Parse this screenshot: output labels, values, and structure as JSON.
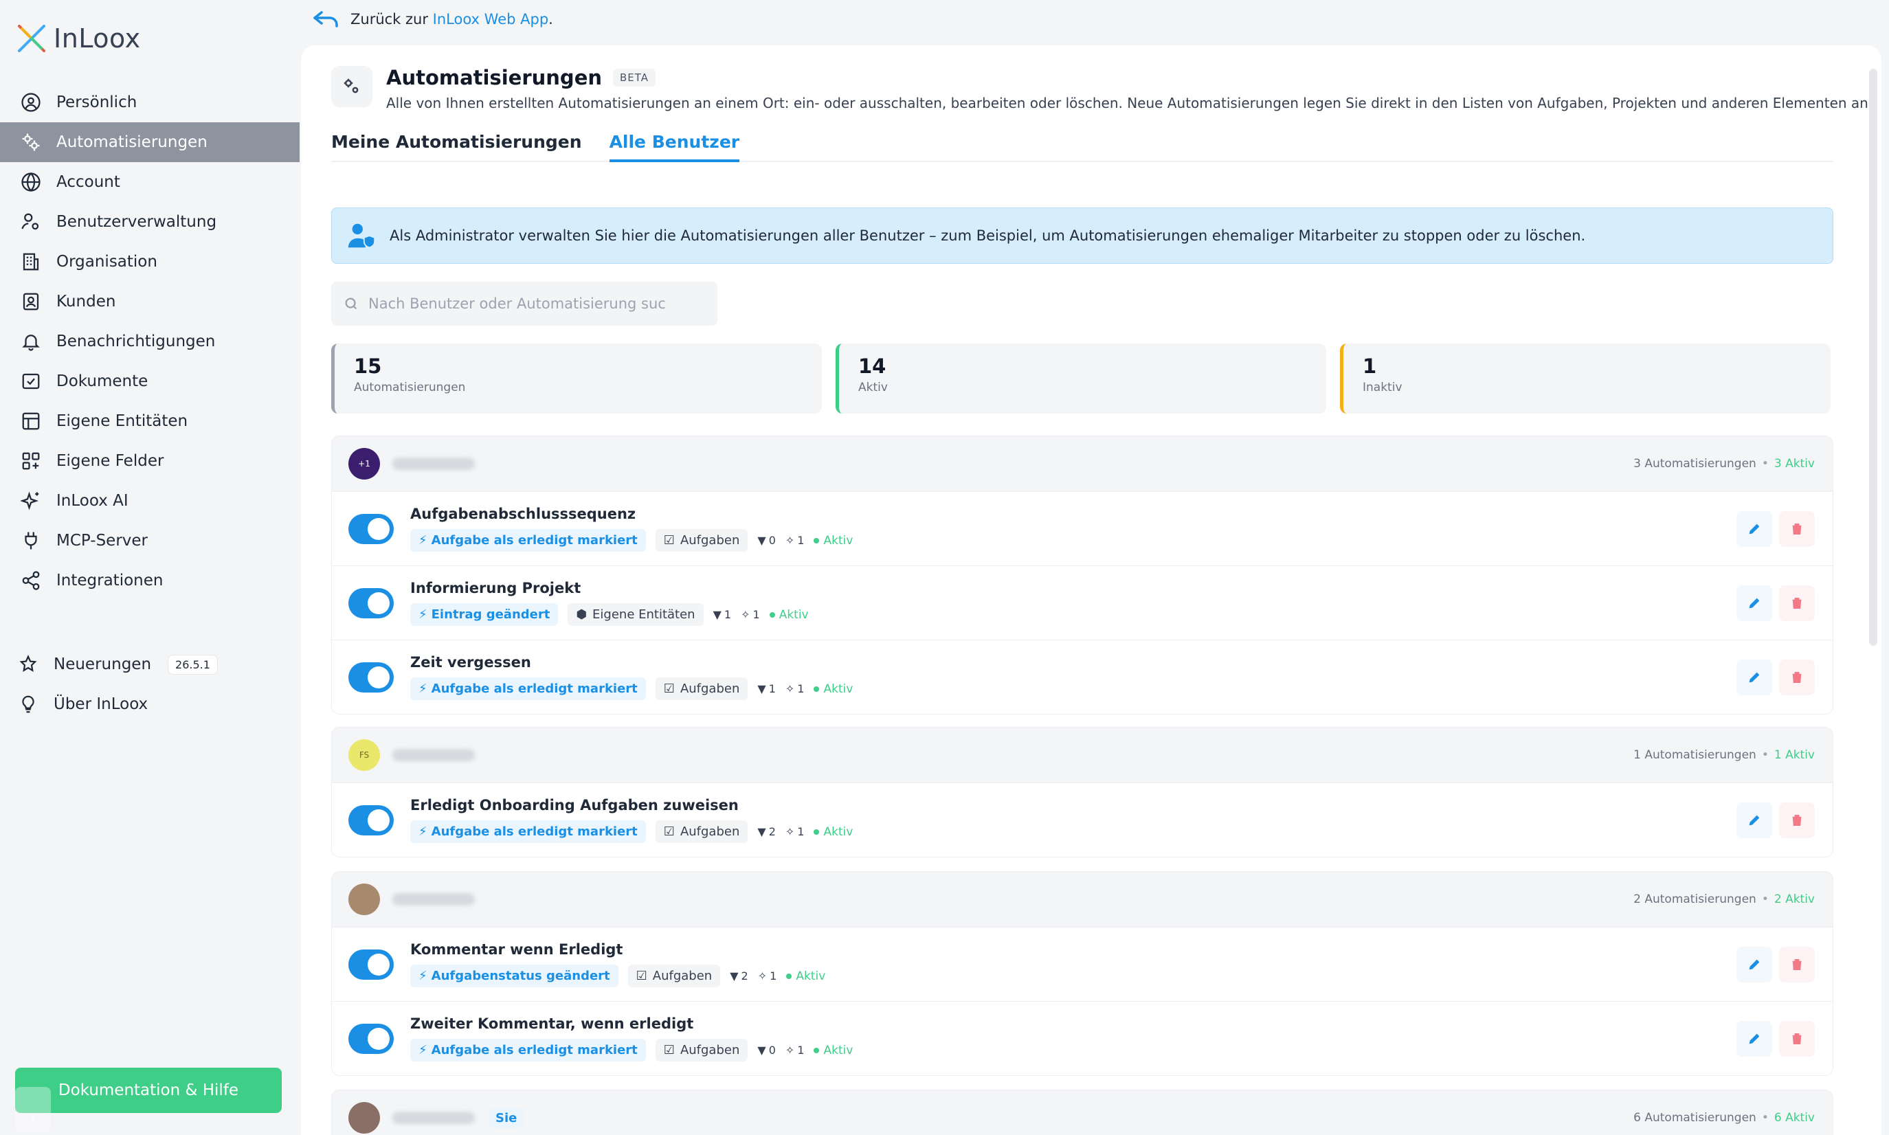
{
  "app": {
    "logo_text": "InLoox"
  },
  "sidebar": {
    "items": [
      {
        "label": "Persönlich",
        "icon": "user-circle-icon",
        "active": false
      },
      {
        "label": "Automatisierungen",
        "icon": "gears-icon",
        "active": true
      },
      {
        "label": "Account",
        "icon": "globe-icon",
        "active": false
      },
      {
        "label": "Benutzerverwaltung",
        "icon": "users-gear-icon",
        "active": false
      },
      {
        "label": "Organisation",
        "icon": "building-icon",
        "active": false
      },
      {
        "label": "Kunden",
        "icon": "contact-book-icon",
        "active": false
      },
      {
        "label": "Benachrichtigungen",
        "icon": "bell-icon",
        "active": false
      },
      {
        "label": "Dokumente",
        "icon": "document-check-icon",
        "active": false
      },
      {
        "label": "Eigene Entitäten",
        "icon": "table-icon",
        "active": false
      },
      {
        "label": "Eigene Felder",
        "icon": "grid-icon",
        "active": false
      },
      {
        "label": "InLoox AI",
        "icon": "sparkles-icon",
        "active": false
      },
      {
        "label": "MCP-Server",
        "icon": "plug-icon",
        "active": false
      },
      {
        "label": "Integrationen",
        "icon": "share-nodes-icon",
        "active": false
      }
    ],
    "secondary": [
      {
        "label": "Neuerungen",
        "icon": "star-sparkle-icon",
        "badge": "26.5.1"
      },
      {
        "label": "Über InLoox",
        "icon": "lightbulb-icon"
      }
    ],
    "help_button": "Dokumentation & Hilfe",
    "collapse_icon": "chevron-right-icon"
  },
  "backlink": {
    "prefix": "Zurück zur ",
    "link_text": "InLoox Web App",
    "suffix": "."
  },
  "header": {
    "title": "Automatisierungen",
    "badge": "BETA",
    "subtitle": "Alle von Ihnen erstellten Automatisierungen an einem Ort: ein- oder ausschalten, bearbeiten oder löschen. Neue Automatisierungen legen Sie direkt in den Listen von Aufgaben, Projekten und anderen Elementen an."
  },
  "tabs": [
    {
      "label": "Meine Automatisierungen",
      "active": false
    },
    {
      "label": "Alle Benutzer",
      "active": true
    }
  ],
  "admin_banner": "Als Administrator verwalten Sie hier die Automatisierungen aller Benutzer – zum Beispiel, um Automatisierungen ehemaliger Mitarbeiter zu stoppen oder zu löschen.",
  "search": {
    "placeholder": "Nach Benutzer oder Automatisierung suc",
    "value": ""
  },
  "stats": [
    {
      "value": "15",
      "label": "Automatisierungen",
      "color": "#9ca3af"
    },
    {
      "value": "14",
      "label": "Aktiv",
      "color": "#3fce88"
    },
    {
      "value": "1",
      "label": "Inaktiv",
      "color": "#f5b016"
    }
  ],
  "groups": [
    {
      "avatar_text": "+1",
      "avatar_color": "#3b1f6e",
      "count_label": "3 Automatisierungen",
      "active_label": "3 Aktiv",
      "automations": [
        {
          "title": "Aufgabenabschlusssequenz",
          "trigger": "Aufgabe als erledigt markiert",
          "entity": "Aufgaben",
          "entity_icon": "checkbox-icon",
          "filters": "0",
          "actions": "1",
          "status": "Aktiv",
          "enabled": true
        },
        {
          "title": "Informierung Projekt",
          "trigger": "Eintrag geändert",
          "entity": "Eigene Entitäten",
          "entity_icon": "cube-icon",
          "filters": "1",
          "actions": "1",
          "status": "Aktiv",
          "enabled": true
        },
        {
          "title": "Zeit vergessen",
          "trigger": "Aufgabe als erledigt markiert",
          "entity": "Aufgaben",
          "entity_icon": "checkbox-icon",
          "filters": "1",
          "actions": "1",
          "status": "Aktiv",
          "enabled": true
        }
      ]
    },
    {
      "avatar_text": "FS",
      "avatar_color": "#e9e86a",
      "count_label": "1 Automatisierungen",
      "active_label": "1 Aktiv",
      "automations": [
        {
          "title": "Erledigt Onboarding Aufgaben zuweisen",
          "trigger": "Aufgabe als erledigt markiert",
          "entity": "Aufgaben",
          "entity_icon": "checkbox-icon",
          "filters": "2",
          "actions": "1",
          "status": "Aktiv",
          "enabled": true
        }
      ]
    },
    {
      "avatar_text": "",
      "avatar_color": "#a7896e",
      "count_label": "2 Automatisierungen",
      "active_label": "2 Aktiv",
      "automations": [
        {
          "title": "Kommentar wenn Erledigt",
          "trigger": "Aufgabenstatus geändert",
          "entity": "Aufgaben",
          "entity_icon": "checkbox-icon",
          "filters": "2",
          "actions": "1",
          "status": "Aktiv",
          "enabled": true
        },
        {
          "title": "Zweiter Kommentar, wenn erledigt",
          "trigger": "Aufgabe als erledigt markiert",
          "entity": "Aufgaben",
          "entity_icon": "checkbox-icon",
          "filters": "0",
          "actions": "1",
          "status": "Aktiv",
          "enabled": true
        }
      ]
    },
    {
      "avatar_text": "",
      "avatar_color": "#8a6f66",
      "you_badge": "Sie",
      "count_label": "6 Automatisierungen",
      "active_label": "6 Aktiv",
      "automations": []
    }
  ],
  "colors": {
    "accent": "#1a8fe3",
    "success": "#3fce88",
    "warning": "#f5b016",
    "active_nav": "#8e949f"
  }
}
